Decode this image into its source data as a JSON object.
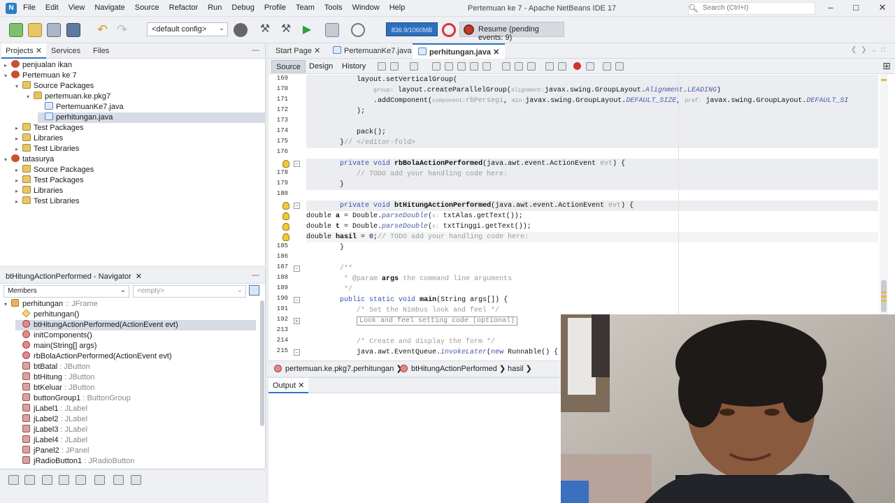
{
  "window": {
    "title": "Pertemuan ke 7 - Apache NetBeans IDE 17"
  },
  "menu": [
    "File",
    "Edit",
    "View",
    "Navigate",
    "Source",
    "Refactor",
    "Run",
    "Debug",
    "Profile",
    "Team",
    "Tools",
    "Window",
    "Help"
  ],
  "search": {
    "placeholder": "Search (Ctrl+I)"
  },
  "toolbar": {
    "config": "<default config>",
    "memory": "836.9/1060MB",
    "resume": "Resume (pending events: 9)"
  },
  "projects_panel": {
    "tabs": [
      "Projects",
      "Services",
      "Files"
    ],
    "tree": [
      {
        "label": "penjualan ikan",
        "level": 0,
        "toggle": "▸",
        "icon": "project"
      },
      {
        "label": "Pertemuan ke 7",
        "level": 0,
        "toggle": "▾",
        "icon": "project"
      },
      {
        "label": "Source Packages",
        "level": 1,
        "toggle": "▾",
        "icon": "srcpkg"
      },
      {
        "label": "pertemuan.ke.pkg7",
        "level": 2,
        "toggle": "▾",
        "icon": "pkg"
      },
      {
        "label": "PertemuanKe7.java",
        "level": 3,
        "toggle": "",
        "icon": "java"
      },
      {
        "label": "perhitungan.java",
        "level": 3,
        "toggle": "",
        "icon": "java"
      },
      {
        "label": "Test Packages",
        "level": 1,
        "toggle": "▸",
        "icon": "srcpkg"
      },
      {
        "label": "Libraries",
        "level": 1,
        "toggle": "▸",
        "icon": "lib"
      },
      {
        "label": "Test Libraries",
        "level": 1,
        "toggle": "▸",
        "icon": "lib"
      },
      {
        "label": "tatasurya",
        "level": 0,
        "toggle": "▾",
        "icon": "project"
      },
      {
        "label": "Source Packages",
        "level": 1,
        "toggle": "▸",
        "icon": "srcpkg"
      },
      {
        "label": "Test Packages",
        "level": 1,
        "toggle": "▸",
        "icon": "srcpkg"
      },
      {
        "label": "Libraries",
        "level": 1,
        "toggle": "▸",
        "icon": "lib"
      },
      {
        "label": "Test Libraries",
        "level": 1,
        "toggle": "▸",
        "icon": "lib"
      }
    ]
  },
  "navigator": {
    "title": "btHitungActionPerformed - Navigator",
    "filter": "Members",
    "empty": "<empty>",
    "members": [
      {
        "name": "perhitungan",
        "type": " :: JFrame",
        "level": 0,
        "icon": "class"
      },
      {
        "name": "perhitungan()",
        "type": "",
        "level": 1,
        "icon": "ctor"
      },
      {
        "name": "btHitungActionPerformed(ActionEvent evt)",
        "type": "",
        "level": 1,
        "icon": "meth",
        "selected": true
      },
      {
        "name": "initComponents()",
        "type": "",
        "level": 1,
        "icon": "meth"
      },
      {
        "name": "main(String[] args)",
        "type": "",
        "level": 1,
        "icon": "meth"
      },
      {
        "name": "rbBolaActionPerformed(ActionEvent evt)",
        "type": "",
        "level": 1,
        "icon": "meth"
      },
      {
        "name": "btBatal",
        "type": " : JButton",
        "level": 1,
        "icon": "field"
      },
      {
        "name": "btHitung",
        "type": " : JButton",
        "level": 1,
        "icon": "field"
      },
      {
        "name": "btKeluar",
        "type": " : JButton",
        "level": 1,
        "icon": "field"
      },
      {
        "name": "buttonGroup1",
        "type": " : ButtonGroup",
        "level": 1,
        "icon": "field"
      },
      {
        "name": "jLabel1",
        "type": " : JLabel",
        "level": 1,
        "icon": "field"
      },
      {
        "name": "jLabel2",
        "type": " : JLabel",
        "level": 1,
        "icon": "field"
      },
      {
        "name": "jLabel3",
        "type": " : JLabel",
        "level": 1,
        "icon": "field"
      },
      {
        "name": "jLabel4",
        "type": " : JLabel",
        "level": 1,
        "icon": "field"
      },
      {
        "name": "jPanel2",
        "type": " : JPanel",
        "level": 1,
        "icon": "field"
      },
      {
        "name": "jRadioButton1",
        "type": " : JRadioButton",
        "level": 1,
        "icon": "field"
      }
    ]
  },
  "editor": {
    "tabs": [
      "Start Page",
      "PertemuanKe7.java",
      "perhitungan.java"
    ],
    "active_tab": "perhitungan.java",
    "views": [
      "Source",
      "Design",
      "History"
    ],
    "lines": [
      {
        "n": "169",
        "text": "            layout.setVerticalGroup(",
        "gray": true
      },
      {
        "n": "170",
        "text": "                <span class=\"hint\">group:</span> layout.createParallelGroup(<span class=\"hint\">alignment:</span>javax.swing.GroupLayout.<span class=\"it\">Alignment</span>.<span class=\"it\">LEADING</span>)",
        "gray": true
      },
      {
        "n": "171",
        "text": "                .addComponent(<span class=\"hint\">component:</span><span class=\"cm\">rbPersegi</span>, <span class=\"hint\">min:</span>javax.swing.GroupLayout.<span class=\"it\">DEFAULT_SIZE</span>, <span class=\"hint\">pref:</span> javax.swing.GroupLayout.<span class=\"it\">DEFAULT_SI</span>",
        "gray": true
      },
      {
        "n": "172",
        "text": "            );",
        "gray": true
      },
      {
        "n": "173",
        "text": "",
        "gray": true
      },
      {
        "n": "174",
        "text": "            pack();",
        "gray": true
      },
      {
        "n": "175",
        "text": "        }<span class=\"cm\">// &lt;/editor-fold&gt;</span>",
        "gray": true
      },
      {
        "n": "176",
        "text": "",
        "gray": false
      },
      {
        "n": "",
        "text": "        <span class=\"kw\">private void</span> <span class=\"b\">rbBolaActionPerformed</span>(java.awt.event.ActionEvent <span class=\"cm\">evt</span>) {",
        "gray": true,
        "bulb": true,
        "fold": "-"
      },
      {
        "n": "178",
        "text": "            <span class=\"cm\">// TODO add your handling code here:</span>",
        "gray": true
      },
      {
        "n": "179",
        "text": "        }",
        "gray": true
      },
      {
        "n": "180",
        "text": "",
        "gray": false
      },
      {
        "n": "",
        "text": "        <span class=\"kw\">private void</span> <span class=\"b\">btHitungActionPerformed</span>(java.awt.event.ActionEvent <span class=\"cm\">evt</span>) {",
        "gray": true,
        "bulb": true,
        "fold": "-"
      },
      {
        "n": "",
        "text": "double <span class=\"b\">a</span> = Double.<span class=\"it\">parseDouble</span>(<span class=\"hint\">s:</span> txtAlas.getText());",
        "gray": false,
        "bulb": true
      },
      {
        "n": "",
        "text": "double <span class=\"b\">t</span> = Double.<span class=\"it\">parseDouble</span>(<span class=\"hint\">s:</span> txtTinggi.getText());",
        "gray": false,
        "bulb": true
      },
      {
        "n": "",
        "text": "double <span class=\"b\">hasil</span> = 0;<span class=\"cm\">// TODO add your handling code here:</span>",
        "gray": false,
        "bulb": true,
        "hl": true
      },
      {
        "n": "185",
        "text": "        }",
        "gray": false
      },
      {
        "n": "186",
        "text": "",
        "gray": false
      },
      {
        "n": "187",
        "text": "        <span class=\"cm\">/**</span>",
        "gray": false,
        "fold": "-"
      },
      {
        "n": "188",
        "text": "         <span class=\"cm\">* @param</span> <span class=\"b\">args</span> <span class=\"cm\">the command line arguments</span>",
        "gray": false
      },
      {
        "n": "189",
        "text": "         <span class=\"cm\">*/</span>",
        "gray": false
      },
      {
        "n": "190",
        "text": "        <span class=\"kw\">public static void</span> <span class=\"b\">main</span>(String args[]) {",
        "gray": false,
        "fold": "-"
      },
      {
        "n": "191",
        "text": "            <span class=\"cm\">/* Set the Nimbus look and feel */</span>",
        "gray": false
      },
      {
        "n": "192",
        "text": "            <span style=\"border:1px solid #999;color:#888;padding:0 3px\">Look and feel setting code (optional)</span>",
        "gray": false,
        "fold": "+"
      },
      {
        "n": "213",
        "text": "",
        "gray": false
      },
      {
        "n": "214",
        "text": "            <span class=\"cm\">/* Create and display the form */</span>",
        "gray": false
      },
      {
        "n": "215",
        "text": "            java.awt.EventQueue.<span class=\"it\">invokeLater</span>(<span class=\"kw\">new</span> Runnable() {",
        "gray": false,
        "fold": "-"
      }
    ]
  },
  "breadcrumb": [
    "pertemuan.ke.pkg7.perhitungan",
    "btHitungActionPerformed",
    "hasil"
  ],
  "output": {
    "tab": "Output"
  },
  "colors": {
    "accent": "#2e74c6",
    "keyword": "#3750b5",
    "comment": "#9a9a9a"
  }
}
